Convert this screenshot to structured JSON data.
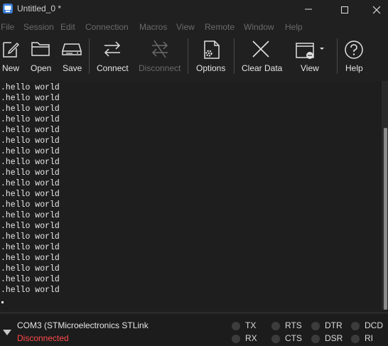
{
  "window": {
    "title": "Untitled_0 *"
  },
  "menu": [
    "File",
    "Session",
    "Edit",
    "Connection",
    "Macros",
    "View",
    "Remote",
    "Window",
    "Help"
  ],
  "toolbar": {
    "new": "New",
    "open": "Open",
    "save": "Save",
    "connect": "Connect",
    "disconnect": "Disconnect",
    "options": "Options",
    "clear_data": "Clear Data",
    "view": "View",
    "help": "Help"
  },
  "terminal": {
    "lines": [
      ".hello world",
      ".hello world",
      ".hello world",
      ".hello world",
      ".hello world",
      ".hello world",
      ".hello world",
      ".hello world",
      ".hello world",
      ".hello world",
      ".hello world",
      ".hello world",
      ".hello world",
      ".hello world",
      ".hello world",
      ".hello world",
      ".hello world",
      ".hello world",
      ".hello world",
      ".hello world"
    ]
  },
  "status": {
    "port": "COM3 (STMicroelectronics STLink",
    "connection": "Disconnected",
    "signals": [
      "TX",
      "RX",
      "RTS",
      "CTS",
      "DTR",
      "DSR",
      "DCD",
      "RI"
    ]
  },
  "colors": {
    "background": "#202020",
    "terminal_bg": "#1e1e1e",
    "disconnected": "#ff4b4b",
    "disabled_text": "#6a6a6a"
  }
}
